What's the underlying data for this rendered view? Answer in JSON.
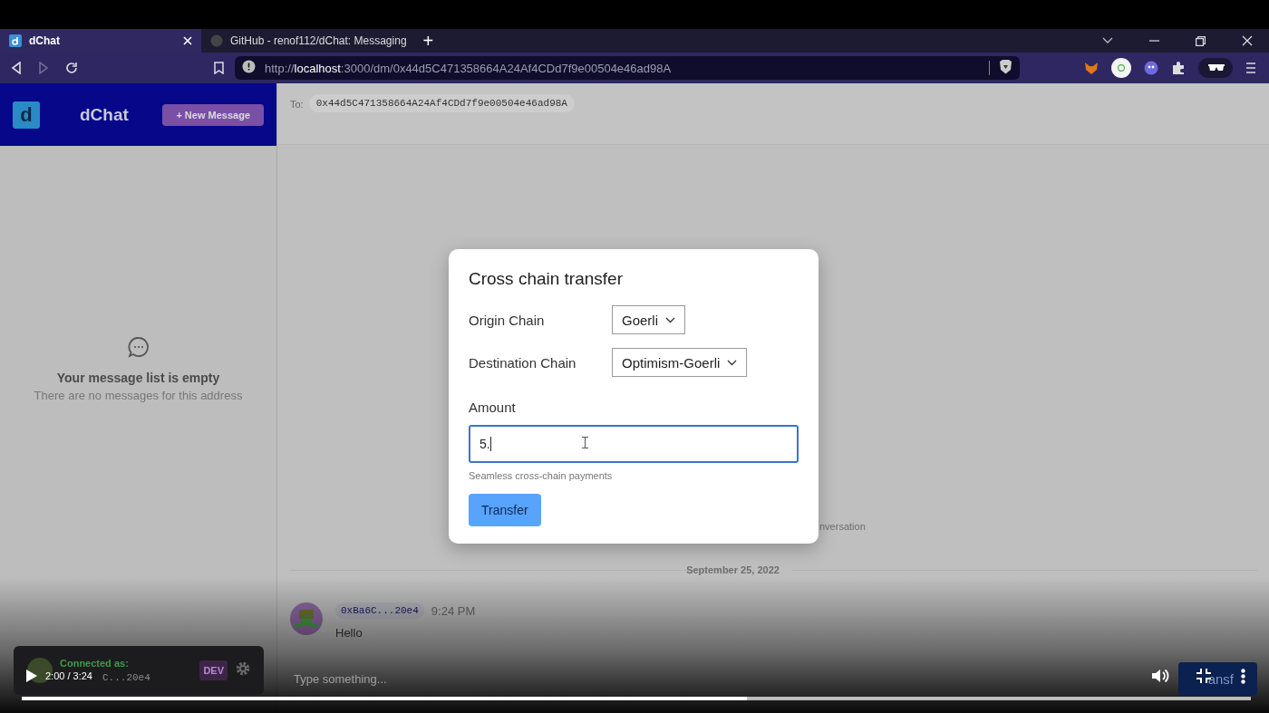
{
  "browser": {
    "tabs": [
      {
        "title": "dChat",
        "selected": true
      },
      {
        "title": "GitHub - renof112/dChat: Messaging",
        "selected": false
      }
    ],
    "new_tab": "+",
    "url": "http://**localhost**:3000/dm/0x44d5C471358664A24Af4CDd7f9e00504e46ad98A"
  },
  "sidebar": {
    "logo_letter": "d",
    "app_name": "dChat",
    "new_message_button": "+ New Message",
    "empty_title": "Your message list is empty",
    "empty_subtitle": "There are no messages for this address",
    "user": {
      "status": "Connected as:",
      "address": "C...20e4",
      "badge": "DEV"
    }
  },
  "conversation": {
    "to_label": "To:",
    "to_address": "0x44d5C471358664A24Af4CDd7f9e00504e46ad98A",
    "note": "nversation",
    "date": "September 25, 2022",
    "messages": [
      {
        "sender": "0xBa6C...20e4",
        "time": "9:24 PM",
        "text": "Hello"
      }
    ],
    "composer": {
      "placeholder": "Type something..."
    },
    "send_button": "ansf"
  },
  "modal": {
    "title": "Cross chain transfer",
    "fields": [
      {
        "kind": "select",
        "label": "Origin Chain",
        "value": "Goerli",
        "focused": false
      },
      {
        "kind": "select",
        "label": "Destination Chain",
        "value": "Optimism-Goerli",
        "focused": false
      },
      {
        "kind": "input",
        "label": "Amount",
        "value": "5.",
        "focused": true
      }
    ],
    "hint": "Seamless cross-chain payments",
    "button": "Transfer"
  },
  "player": {
    "time": "2:00 / 3:24",
    "progress": {
      "level": 0.59
    }
  }
}
